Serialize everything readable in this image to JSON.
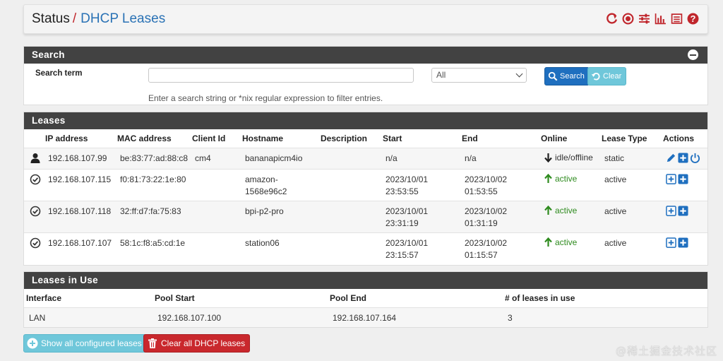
{
  "breadcrumb": {
    "parent": "Status",
    "separator": "/",
    "current": "DHCP Leases"
  },
  "header_icons": [
    "reload-icon",
    "stop-icon",
    "sliders-icon",
    "chart-icon",
    "log-icon",
    "help-icon"
  ],
  "search": {
    "title": "Search",
    "label": "Search term",
    "input_value": "",
    "select_value": "All",
    "search_button": "Search",
    "clear_button": "Clear",
    "help": "Enter a search string or *nix regular expression to filter entries."
  },
  "leases": {
    "title": "Leases",
    "columns": [
      "IP address",
      "MAC address",
      "Client Id",
      "Hostname",
      "Description",
      "Start",
      "End",
      "Online",
      "Lease Type",
      "Actions"
    ],
    "rows": [
      {
        "icon": "user-icon",
        "ip": "192.168.107.99",
        "mac": "be:83:77:ad:88:c8",
        "client_id": "cm4",
        "hostname": "bananapicm4io",
        "hostname2": "",
        "description": "",
        "start": "n/a",
        "start2": "",
        "end": "n/a",
        "end2": "",
        "online": "idle/offline",
        "online_state": "idle",
        "lease_type": "static",
        "actions": [
          "edit-icon",
          "add-icon",
          "power-icon"
        ]
      },
      {
        "icon": "check-circle-icon",
        "ip": "192.168.107.115",
        "mac": "f0:81:73:22:1e:80",
        "client_id": "",
        "hostname": "amazon-",
        "hostname2": "1568e96c2",
        "description": "",
        "start": "2023/10/01",
        "start2": "23:53:55",
        "end": "2023/10/02",
        "end2": "01:53:55",
        "online": "active",
        "online_state": "active",
        "lease_type": "active",
        "actions": [
          "add-mapping-icon",
          "add-icon"
        ]
      },
      {
        "icon": "check-circle-icon",
        "ip": "192.168.107.118",
        "mac": "32:ff:d7:fa:75:83",
        "client_id": "",
        "hostname": "bpi-p2-pro",
        "hostname2": "",
        "description": "",
        "start": "2023/10/01",
        "start2": "23:31:19",
        "end": "2023/10/02",
        "end2": "01:31:19",
        "online": "active",
        "online_state": "active",
        "lease_type": "active",
        "actions": [
          "add-mapping-icon",
          "add-icon"
        ]
      },
      {
        "icon": "check-circle-icon",
        "ip": "192.168.107.107",
        "mac": "58:1c:f8:a5:cd:1e",
        "client_id": "",
        "hostname": "station06",
        "hostname2": "",
        "description": "",
        "start": "2023/10/01",
        "start2": "23:15:57",
        "end": "2023/10/02",
        "end2": "01:15:57",
        "online": "active",
        "online_state": "active",
        "lease_type": "active",
        "actions": [
          "add-mapping-icon",
          "add-icon"
        ]
      }
    ]
  },
  "in_use": {
    "title": "Leases in Use",
    "columns": [
      "Interface",
      "Pool Start",
      "Pool End",
      "# of leases in use"
    ],
    "row": {
      "interface": "LAN",
      "pool_start": "192.168.107.100",
      "pool_end": "192.168.107.164",
      "count": "3"
    }
  },
  "footer_buttons": {
    "show_all": "Show all configured leases",
    "clear_all": "Clear all DHCP leases"
  },
  "watermark": "@稀土掘金技术社区",
  "colors": {
    "accent": "#2a72b5",
    "panel_header": "#424242",
    "danger": "#c9282d",
    "info": "#6fc7da",
    "primary": "#1f6fbf",
    "active": "#2e8b1e"
  }
}
